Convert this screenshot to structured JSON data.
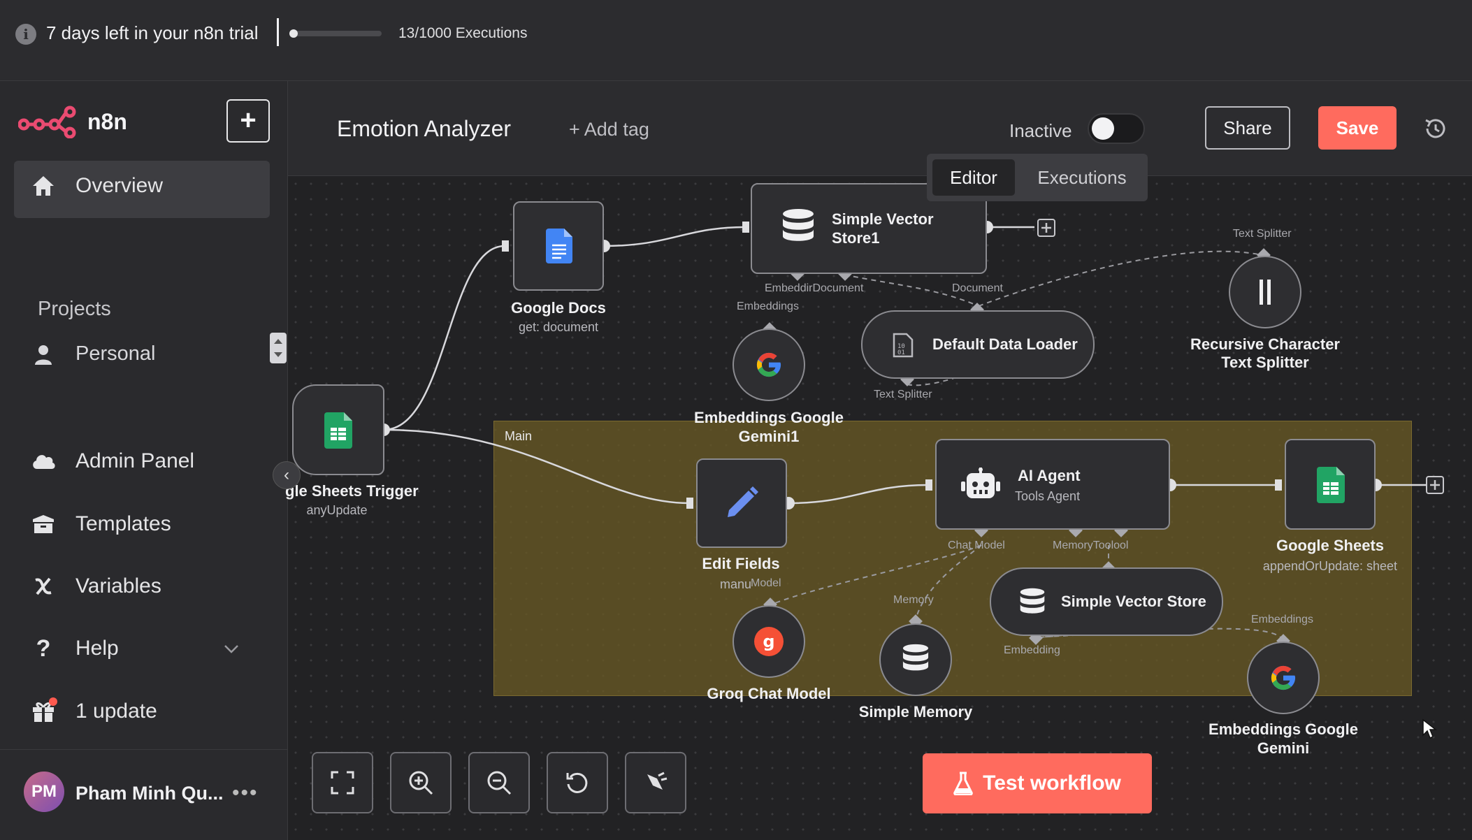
{
  "trial": {
    "info_icon": "info-icon",
    "text": "7 days left in your n8n trial",
    "executions_used": 13,
    "executions_total": 1000,
    "executions_label": "13/1000 Executions"
  },
  "sidebar": {
    "logo": "n8n",
    "new_button": "+",
    "items": [
      {
        "label": "Overview",
        "icon": "home-icon"
      },
      {
        "label": "Projects"
      },
      {
        "label": "Personal",
        "icon": "user-icon"
      },
      {
        "label": "Admin Panel",
        "icon": "cloud-icon"
      },
      {
        "label": "Templates",
        "icon": "box-icon"
      },
      {
        "label": "Variables",
        "icon": "variable-icon"
      },
      {
        "label": "Help",
        "icon": "help-icon"
      },
      {
        "label": "1 update",
        "icon": "gift-icon"
      }
    ],
    "user": {
      "initials": "PM",
      "name": "Pham Minh Qu...",
      "more": "•••"
    }
  },
  "header": {
    "workflow_name": "Emotion Analyzer",
    "add_tag": "+ Add tag",
    "status": "Inactive",
    "share": "Share",
    "save": "Save"
  },
  "tabs": {
    "editor": "Editor",
    "executions": "Executions"
  },
  "canvas": {
    "group_label": "Main",
    "nodes": {
      "sheets_trigger": {
        "title": "gle Sheets Trigger",
        "sub": "anyUpdate"
      },
      "google_docs": {
        "title": "Google Docs",
        "sub": "get: document"
      },
      "vector_store1": {
        "title": "Simple Vector Store1"
      },
      "embeddings_gemini1": {
        "title": "Embeddings Google Gemini1"
      },
      "data_loader": {
        "title": "Default Data Loader"
      },
      "text_splitter": {
        "title": "Recursive Character Text Splitter"
      },
      "edit_fields": {
        "title": "Edit Fields",
        "sub": "manu"
      },
      "ai_agent": {
        "title": "AI Agent",
        "sub": "Tools Agent"
      },
      "google_sheets": {
        "title": "Google Sheets",
        "sub": "appendOrUpdate: sheet"
      },
      "groq": {
        "title": "Groq Chat Model"
      },
      "simple_memory": {
        "title": "Simple Memory"
      },
      "vector_store": {
        "title": "Simple Vector Store"
      },
      "embeddings_gemini": {
        "title": "Embeddings Google Gemini"
      }
    },
    "connectors": {
      "embedding_doc": "EmbeddirDocument",
      "embeddings": "Embeddings",
      "document": "Document",
      "text_splitter_top": "Text Splitter",
      "text_splitter_bottom": "Text Splitter",
      "chat_model": "Chat Model",
      "memory_tool": "MemoryToolool",
      "model": "Model",
      "memory": "Memory",
      "embeddings2": "Embeddings",
      "embedding": "Embedding"
    }
  },
  "controls": {
    "buttons": [
      "fit-view-icon",
      "zoom-in-icon",
      "zoom-out-icon",
      "reset-zoom-icon",
      "tidy-up-icon"
    ],
    "test_workflow": "Test workflow"
  }
}
